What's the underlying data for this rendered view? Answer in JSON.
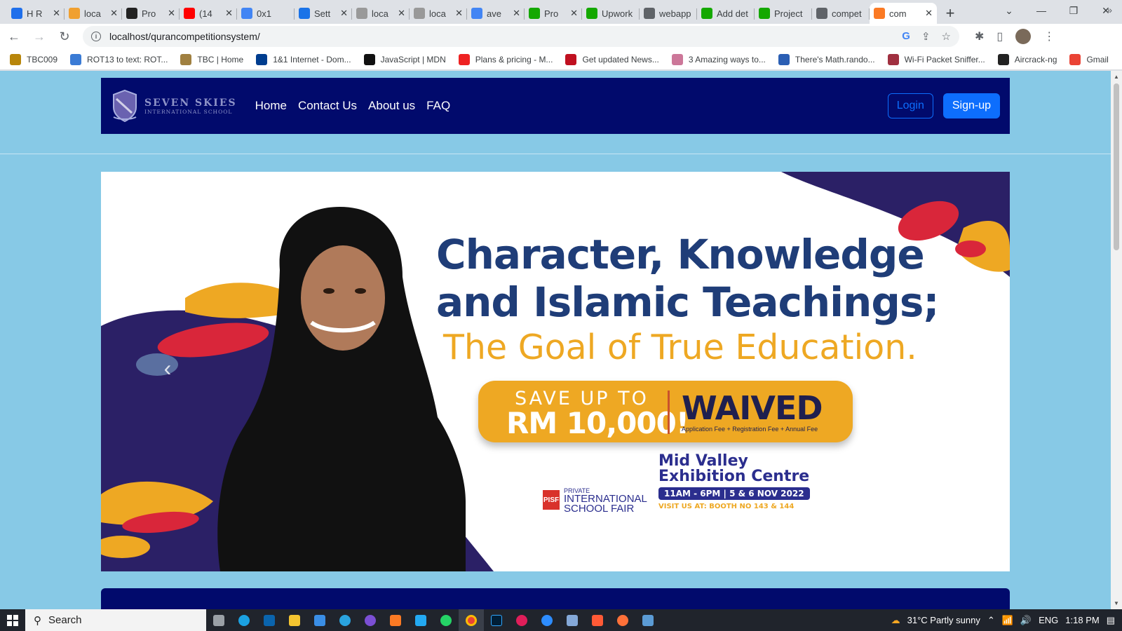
{
  "browser": {
    "tabs": [
      {
        "title": "H R",
        "favicon": "github-icon",
        "color": "#1f6feb"
      },
      {
        "title": "loca",
        "favicon": "pma-icon",
        "color": "#f0a030"
      },
      {
        "title": "Pro",
        "favicon": "alx-icon",
        "color": "#222222"
      },
      {
        "title": "(14",
        "favicon": "youtube-icon",
        "color": "#ff0000"
      },
      {
        "title": "0x1",
        "favicon": "docs-icon",
        "color": "#4285f4"
      },
      {
        "title": "Sett",
        "favicon": "settings-icon",
        "color": "#1a73e8"
      },
      {
        "title": "loca",
        "favicon": "xampp-icon",
        "color": "#999999"
      },
      {
        "title": "loca",
        "favicon": "pma-icon",
        "color": "#999999"
      },
      {
        "title": "ave",
        "favicon": "google-icon",
        "color": "#4285f4"
      },
      {
        "title": "Pro",
        "favicon": "upwork-icon",
        "color": "#14a800"
      },
      {
        "title": "Upwork",
        "favicon": "upwork-icon",
        "color": "#14a800"
      },
      {
        "title": "webapp",
        "favicon": "globe-icon",
        "color": "#5f6368"
      },
      {
        "title": "Add det",
        "favicon": "upwork-icon",
        "color": "#14a800"
      },
      {
        "title": "Project",
        "favicon": "upwork-icon",
        "color": "#14a800"
      },
      {
        "title": "compet",
        "favicon": "globe-icon",
        "color": "#5f6368"
      },
      {
        "title": "com",
        "favicon": "xampp-icon",
        "color": "#fb7a24",
        "active": true
      }
    ],
    "new_tab": "+",
    "url": "localhost/qurancompetitionsystem/",
    "bookmarks": [
      {
        "label": "TBC009",
        "color": "#b8860b"
      },
      {
        "label": "ROT13 to text: ROT...",
        "color": "#3a7bd5"
      },
      {
        "label": "TBC | Home",
        "color": "#a08040"
      },
      {
        "label": "1&1 Internet - Dom...",
        "color": "#003d8f"
      },
      {
        "label": "JavaScript | MDN",
        "color": "#111111"
      },
      {
        "label": "Plans & pricing - M...",
        "color": "#e22"
      },
      {
        "label": "Get updated News...",
        "color": "#c01020"
      },
      {
        "label": "3 Amazing ways to...",
        "color": "#c79"
      },
      {
        "label": "There's Math.rando...",
        "color": "#2b5fb4"
      },
      {
        "label": "Wi-Fi Packet Sniffer...",
        "color": "#a03040"
      },
      {
        "label": "Aircrack-ng",
        "color": "#222222"
      },
      {
        "label": "Gmail",
        "color": "#ea4335"
      }
    ]
  },
  "site": {
    "logo_line1": "SEVEN SKIES",
    "logo_line2": "INTERNATIONAL SCHOOL",
    "nav": [
      "Home",
      "Contact Us",
      "About us",
      "FAQ"
    ],
    "login": "Login",
    "signup": "Sign-up",
    "banner": {
      "line1": "Character, Knowledge",
      "line2": "and Islamic Teachings;",
      "line3": "The Goal of True Education.",
      "save_label": "SAVE UP TO",
      "save_amount": "RM 10,000!",
      "waived": "WAIVED",
      "waived_sub": "Application Fee + Registration Fee + Annual Fee",
      "venue1": "Mid Valley",
      "venue2": "Exhibition Centre",
      "venue_time": "11AM - 6PM | 5 & 6 NOV 2022",
      "venue_booth": "VISIT US AT: BOOTH NO 143 & 144",
      "fair_logo": "PISF",
      "fair1": "PRIVATE",
      "fair2": "INTERNATIONAL",
      "fair3": "SCHOOL FAIR"
    },
    "prev_arrow": "‹"
  },
  "taskbar": {
    "search": "Search",
    "weather": "31°C  Partly sunny",
    "lang": "ENG",
    "time": "1:18 PM"
  }
}
